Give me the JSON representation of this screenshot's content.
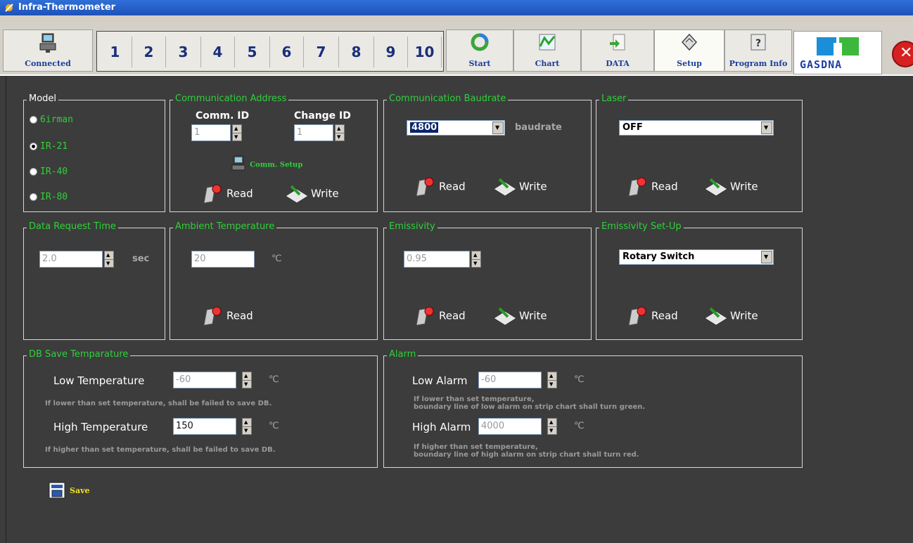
{
  "window": {
    "title": "Infra-Thermometer"
  },
  "toolbar": {
    "connected_label": "Connected",
    "channels": [
      "1",
      "2",
      "3",
      "4",
      "5",
      "6",
      "7",
      "8",
      "9",
      "10"
    ],
    "start_label": "Start",
    "chart_label": "Chart",
    "data_label": "DATA",
    "setup_label": "Setup",
    "program_info_label": "Program Info",
    "logo_text": "GASDNA"
  },
  "model": {
    "title": "Model",
    "options": [
      "6irman",
      "IR-21",
      "IR-40",
      "IR-80"
    ],
    "selected": "IR-21"
  },
  "comm_address": {
    "title": "Communication Address",
    "comm_id_label": "Comm. ID",
    "comm_id_value": "1",
    "change_id_label": "Change ID",
    "change_id_value": "1",
    "comm_setup_label": "Comm. Setup",
    "read_label": "Read",
    "write_label": "Write"
  },
  "baudrate": {
    "title": "Communication Baudrate",
    "value": "4800",
    "unit": "baudrate",
    "read_label": "Read",
    "write_label": "Write"
  },
  "laser": {
    "title": "Laser",
    "value": "OFF",
    "read_label": "Read",
    "write_label": "Write"
  },
  "data_request": {
    "title": "Data Request Time",
    "value": "2.0",
    "unit": "sec"
  },
  "ambient": {
    "title": "Ambient Temperature",
    "value": "20",
    "unit": "℃",
    "read_label": "Read"
  },
  "emissivity": {
    "title": "Emissivity",
    "value": "0.95",
    "read_label": "Read",
    "write_label": "Write"
  },
  "emissivity_setup": {
    "title": "Emissivity Set-Up",
    "value": "Rotary Switch",
    "read_label": "Read",
    "write_label": "Write"
  },
  "db_save": {
    "title": "DB Save Temparature",
    "low_label": "Low Temperature",
    "low_value": "-60",
    "low_unit": "℃",
    "low_note": "If lower than set temperature, shall be failed to save DB.",
    "high_label": "High Temperature",
    "high_value": "150",
    "high_unit": "℃",
    "high_note": "If higher than set temperature, shall be failed to save DB."
  },
  "alarm": {
    "title": "Alarm",
    "low_label": "Low Alarm",
    "low_value": "-60",
    "low_unit": "℃",
    "low_note_1": "If lower than set temperature,",
    "low_note_2": "boundary line of low alarm on strip chart shall turn green.",
    "high_label": "High Alarm",
    "high_value": "4000",
    "high_unit": "℃",
    "high_note_1": "If higher than set temperature,",
    "high_note_2": "boundary line of high alarm on strip chart shall turn red."
  },
  "save_label": "Save"
}
